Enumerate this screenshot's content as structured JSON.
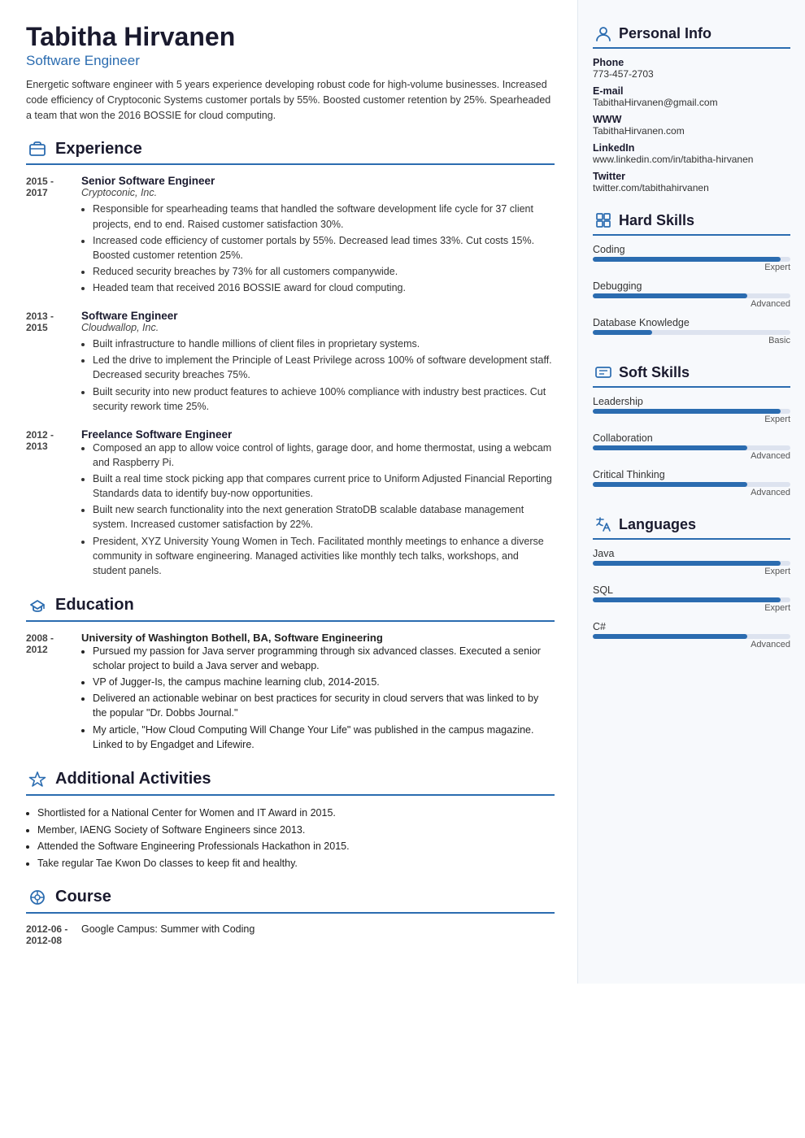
{
  "header": {
    "name": "Tabitha Hirvanen",
    "subtitle": "Software Engineer",
    "summary": "Energetic software engineer with 5 years experience developing robust code for high-volume businesses. Increased code efficiency of Cryptoconic Systems customer portals by 55%. Boosted customer retention by 25%. Spearheaded a team that won the 2016 BOSSIE for cloud computing."
  },
  "sections": {
    "experience_label": "Experience",
    "education_label": "Education",
    "activities_label": "Additional Activities",
    "course_label": "Course"
  },
  "experience": [
    {
      "dates": "2015 -\n2017",
      "title": "Senior Software Engineer",
      "company": "Cryptoconic, Inc.",
      "bullets": [
        "Responsible for spearheading teams that handled the software development life cycle for 37 client projects, end to end. Raised customer satisfaction 30%.",
        "Increased code efficiency of customer portals by 55%. Decreased lead times 33%. Cut costs 15%. Boosted customer retention 25%.",
        "Reduced security breaches by 73% for all customers companywide.",
        "Headed team that received 2016 BOSSIE award for cloud computing."
      ]
    },
    {
      "dates": "2013 -\n2015",
      "title": "Software Engineer",
      "company": "Cloudwallop, Inc.",
      "bullets": [
        "Built infrastructure to handle millions of client files in proprietary systems.",
        "Led the drive to implement the Principle of Least Privilege across 100% of software development staff. Decreased security breaches 75%.",
        "Built security into new product features to achieve 100% compliance with industry best practices. Cut security rework time 25%."
      ]
    },
    {
      "dates": "2012 -\n2013",
      "title": "Freelance Software Engineer",
      "company": "",
      "bullets": [
        "Composed an app to allow voice control of lights, garage door, and home thermostat, using a webcam and Raspberry Pi.",
        "Built a real time stock picking app that compares current price to Uniform Adjusted Financial Reporting Standards data to identify buy-now opportunities.",
        "Built new search functionality into the next generation StratoDB scalable database management system. Increased customer satisfaction by 22%.",
        "President, XYZ University Young Women in Tech. Facilitated monthly meetings to enhance a diverse community in software engineering. Managed activities like monthly tech talks, workshops, and student panels."
      ]
    }
  ],
  "education": [
    {
      "dates": "2008 -\n2012",
      "degree": "University of Washington Bothell, BA, Software Engineering",
      "bullets": [
        "Pursued my passion for Java server programming through six advanced classes. Executed a senior scholar project to build a Java server and webapp.",
        "VP of Jugger-Is, the campus machine learning club, 2014-2015.",
        "Delivered an actionable webinar on best practices for security in cloud servers that was linked to by the popular \"Dr. Dobbs Journal.\"",
        "My article, \"How Cloud Computing Will Change Your Life\" was published in the campus magazine. Linked to by Engadget and Lifewire."
      ]
    }
  ],
  "activities": [
    "Shortlisted for a National Center for Women and IT Award in 2015.",
    "Member, IAENG Society of Software Engineers since 2013.",
    "Attended the Software Engineering Professionals Hackathon in 2015.",
    "Take regular Tae Kwon Do classes to keep fit and healthy."
  ],
  "courses": [
    {
      "dates": "2012-06 -\n2012-08",
      "name": "Google Campus: Summer with Coding"
    }
  ],
  "personal_info": {
    "section_label": "Personal Info",
    "phone_label": "Phone",
    "phone": "773-457-2703",
    "email_label": "E-mail",
    "email": "TabithaHirvanen@gmail.com",
    "www_label": "WWW",
    "www": "TabithaHirvanen.com",
    "linkedin_label": "LinkedIn",
    "linkedin": "www.linkedin.com/in/tabitha-hirvanen",
    "twitter_label": "Twitter",
    "twitter": "twitter.com/tabithahirvanen"
  },
  "hard_skills": {
    "label": "Hard Skills",
    "items": [
      {
        "name": "Coding",
        "level": "Expert",
        "pct": 95
      },
      {
        "name": "Debugging",
        "level": "Advanced",
        "pct": 78
      },
      {
        "name": "Database Knowledge",
        "level": "Basic",
        "pct": 30
      }
    ]
  },
  "soft_skills": {
    "label": "Soft Skills",
    "items": [
      {
        "name": "Leadership",
        "level": "Expert",
        "pct": 95
      },
      {
        "name": "Collaboration",
        "level": "Advanced",
        "pct": 78
      },
      {
        "name": "Critical Thinking",
        "level": "Advanced",
        "pct": 78
      }
    ]
  },
  "languages": {
    "label": "Languages",
    "items": [
      {
        "name": "Java",
        "level": "Expert",
        "pct": 95
      },
      {
        "name": "SQL",
        "level": "Expert",
        "pct": 95
      },
      {
        "name": "C#",
        "level": "Advanced",
        "pct": 78
      }
    ]
  }
}
